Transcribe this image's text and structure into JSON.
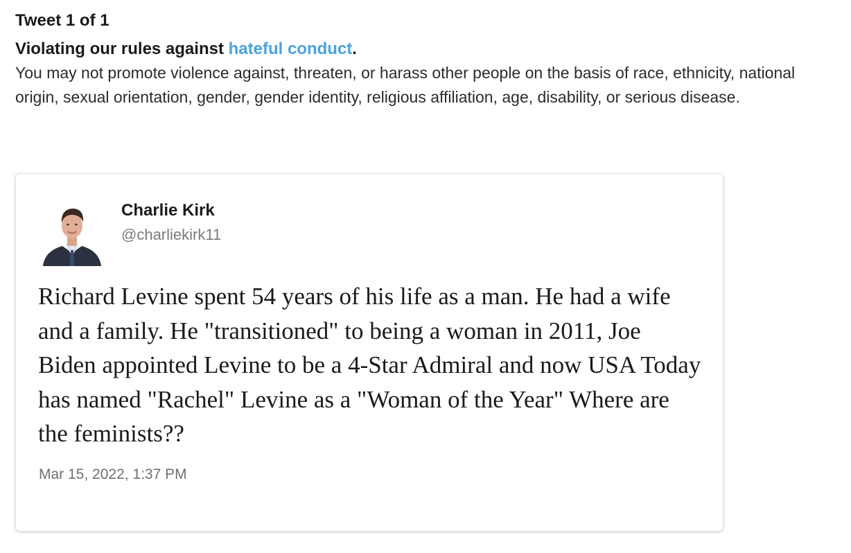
{
  "header": {
    "tweet_count": "Tweet 1 of 1",
    "violation_prefix": "Violating our rules against ",
    "violation_link": "hateful conduct",
    "violation_suffix": ".",
    "description": "You may not promote violence against, threaten, or harass other people on the basis of race, ethnicity, national origin, sexual orientation, gender, gender identity, religious affiliation, age, disability, or serious disease.",
    "link_color": "#4aa3df"
  },
  "tweet": {
    "author_name": "Charlie Kirk",
    "author_handle": "@charliekirk11",
    "avatar_icon": "profile-photo",
    "text": "Richard Levine spent 54 years of his life as a man. He had a wife and a family. He \"transitioned\" to being a woman in 2011, Joe Biden appointed Levine to be a 4-Star Admiral and now USA Today has named \"Rachel\" Levine as a \"Woman of the Year\" Where are the feminists??",
    "timestamp": "Mar 15, 2022, 1:37 PM"
  }
}
